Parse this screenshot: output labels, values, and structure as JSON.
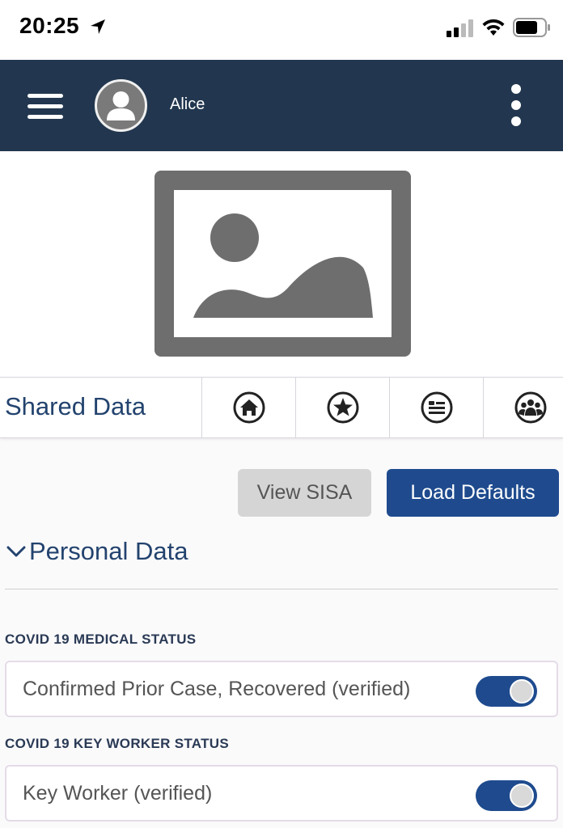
{
  "status_bar": {
    "time": "20:25"
  },
  "header": {
    "user_name": "Alice"
  },
  "tabs": {
    "title": "Shared Data",
    "icons": [
      "home-icon",
      "star-icon",
      "list-icon",
      "group-icon"
    ]
  },
  "actions": {
    "view_sisa": "View SISA",
    "load_defaults": "Load Defaults"
  },
  "section": {
    "title": "Personal Data"
  },
  "fields": [
    {
      "label": "COVID 19 MEDICAL STATUS",
      "value": "Confirmed Prior Case, Recovered (verified)",
      "enabled": true
    },
    {
      "label": "COVID 19 KEY WORKER STATUS",
      "value": "Key Worker (verified)",
      "enabled": true
    }
  ],
  "colors": {
    "header_bg": "#22374f",
    "accent": "#1f4b8e",
    "title": "#23436e"
  }
}
